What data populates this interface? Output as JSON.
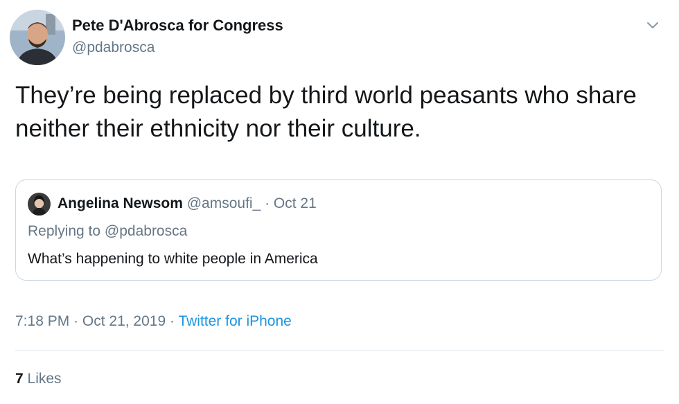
{
  "author": {
    "name": "Pete D'Abrosca for Congress",
    "handle": "@pdabrosca"
  },
  "tweet": {
    "text": "They’re being replaced by third world peasants who share neither their ethnicity nor their culture."
  },
  "quoted_tweet": {
    "name": "Angelina Newsom",
    "handle": "@amsoufi_",
    "separator": " · ",
    "date": "Oct 21",
    "replying_prefix": "Replying to ",
    "replying_to": "@pdabrosca",
    "text": "What’s happening to white people in America"
  },
  "meta": {
    "time": "7:18 PM",
    "date": "Oct 21, 2019",
    "separator": " · ",
    "source": "Twitter for iPhone"
  },
  "stats": {
    "likes_count": "7",
    "likes_label": " Likes"
  },
  "icons": {
    "caret": "chevron-down-icon"
  },
  "colors": {
    "text_primary": "#14171a",
    "text_secondary": "#657786",
    "link": "#1b95e0",
    "border": "#ccd6dd"
  }
}
